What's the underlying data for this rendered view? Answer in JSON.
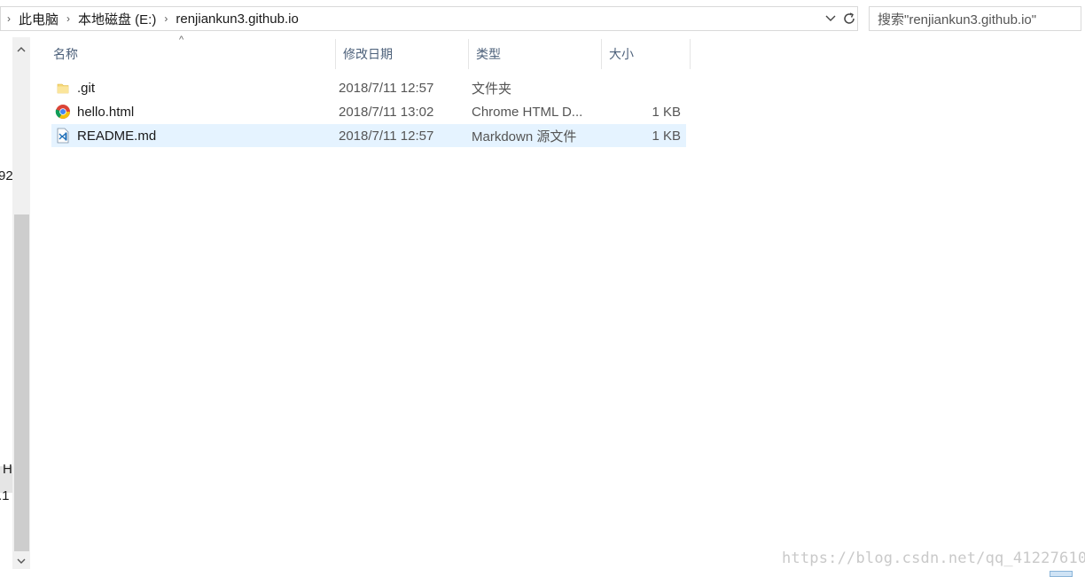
{
  "address_bar": {
    "crumbs": [
      "此电脑",
      "本地磁盘 (E:)",
      "renjiankun3.github.io"
    ]
  },
  "search": {
    "placeholder": "搜索\"renjiankun3.github.io\""
  },
  "columns": {
    "name": "名称",
    "date": "修改日期",
    "type": "类型",
    "size": "大小"
  },
  "files": [
    {
      "name": ".git",
      "date": "2018/7/11 12:57",
      "type": "文件夹",
      "size": "",
      "icon": "folder-icon"
    },
    {
      "name": "hello.html",
      "date": "2018/7/11 13:02",
      "type": "Chrome HTML D...",
      "size": "1 KB",
      "icon": "chrome-icon"
    },
    {
      "name": "README.md",
      "date": "2018/7/11 12:57",
      "type": "Markdown 源文件",
      "size": "1 KB",
      "icon": "vscode-file-icon",
      "selected": true
    }
  ],
  "nav_fragments": [
    "92",
    "H",
    ".1"
  ],
  "watermark": "https://blog.csdn.net/qq_41227610",
  "colors": {
    "selection": "#e5f3ff",
    "header_text": "#4c607a",
    "scroll_thumb": "#cdcdcd"
  }
}
